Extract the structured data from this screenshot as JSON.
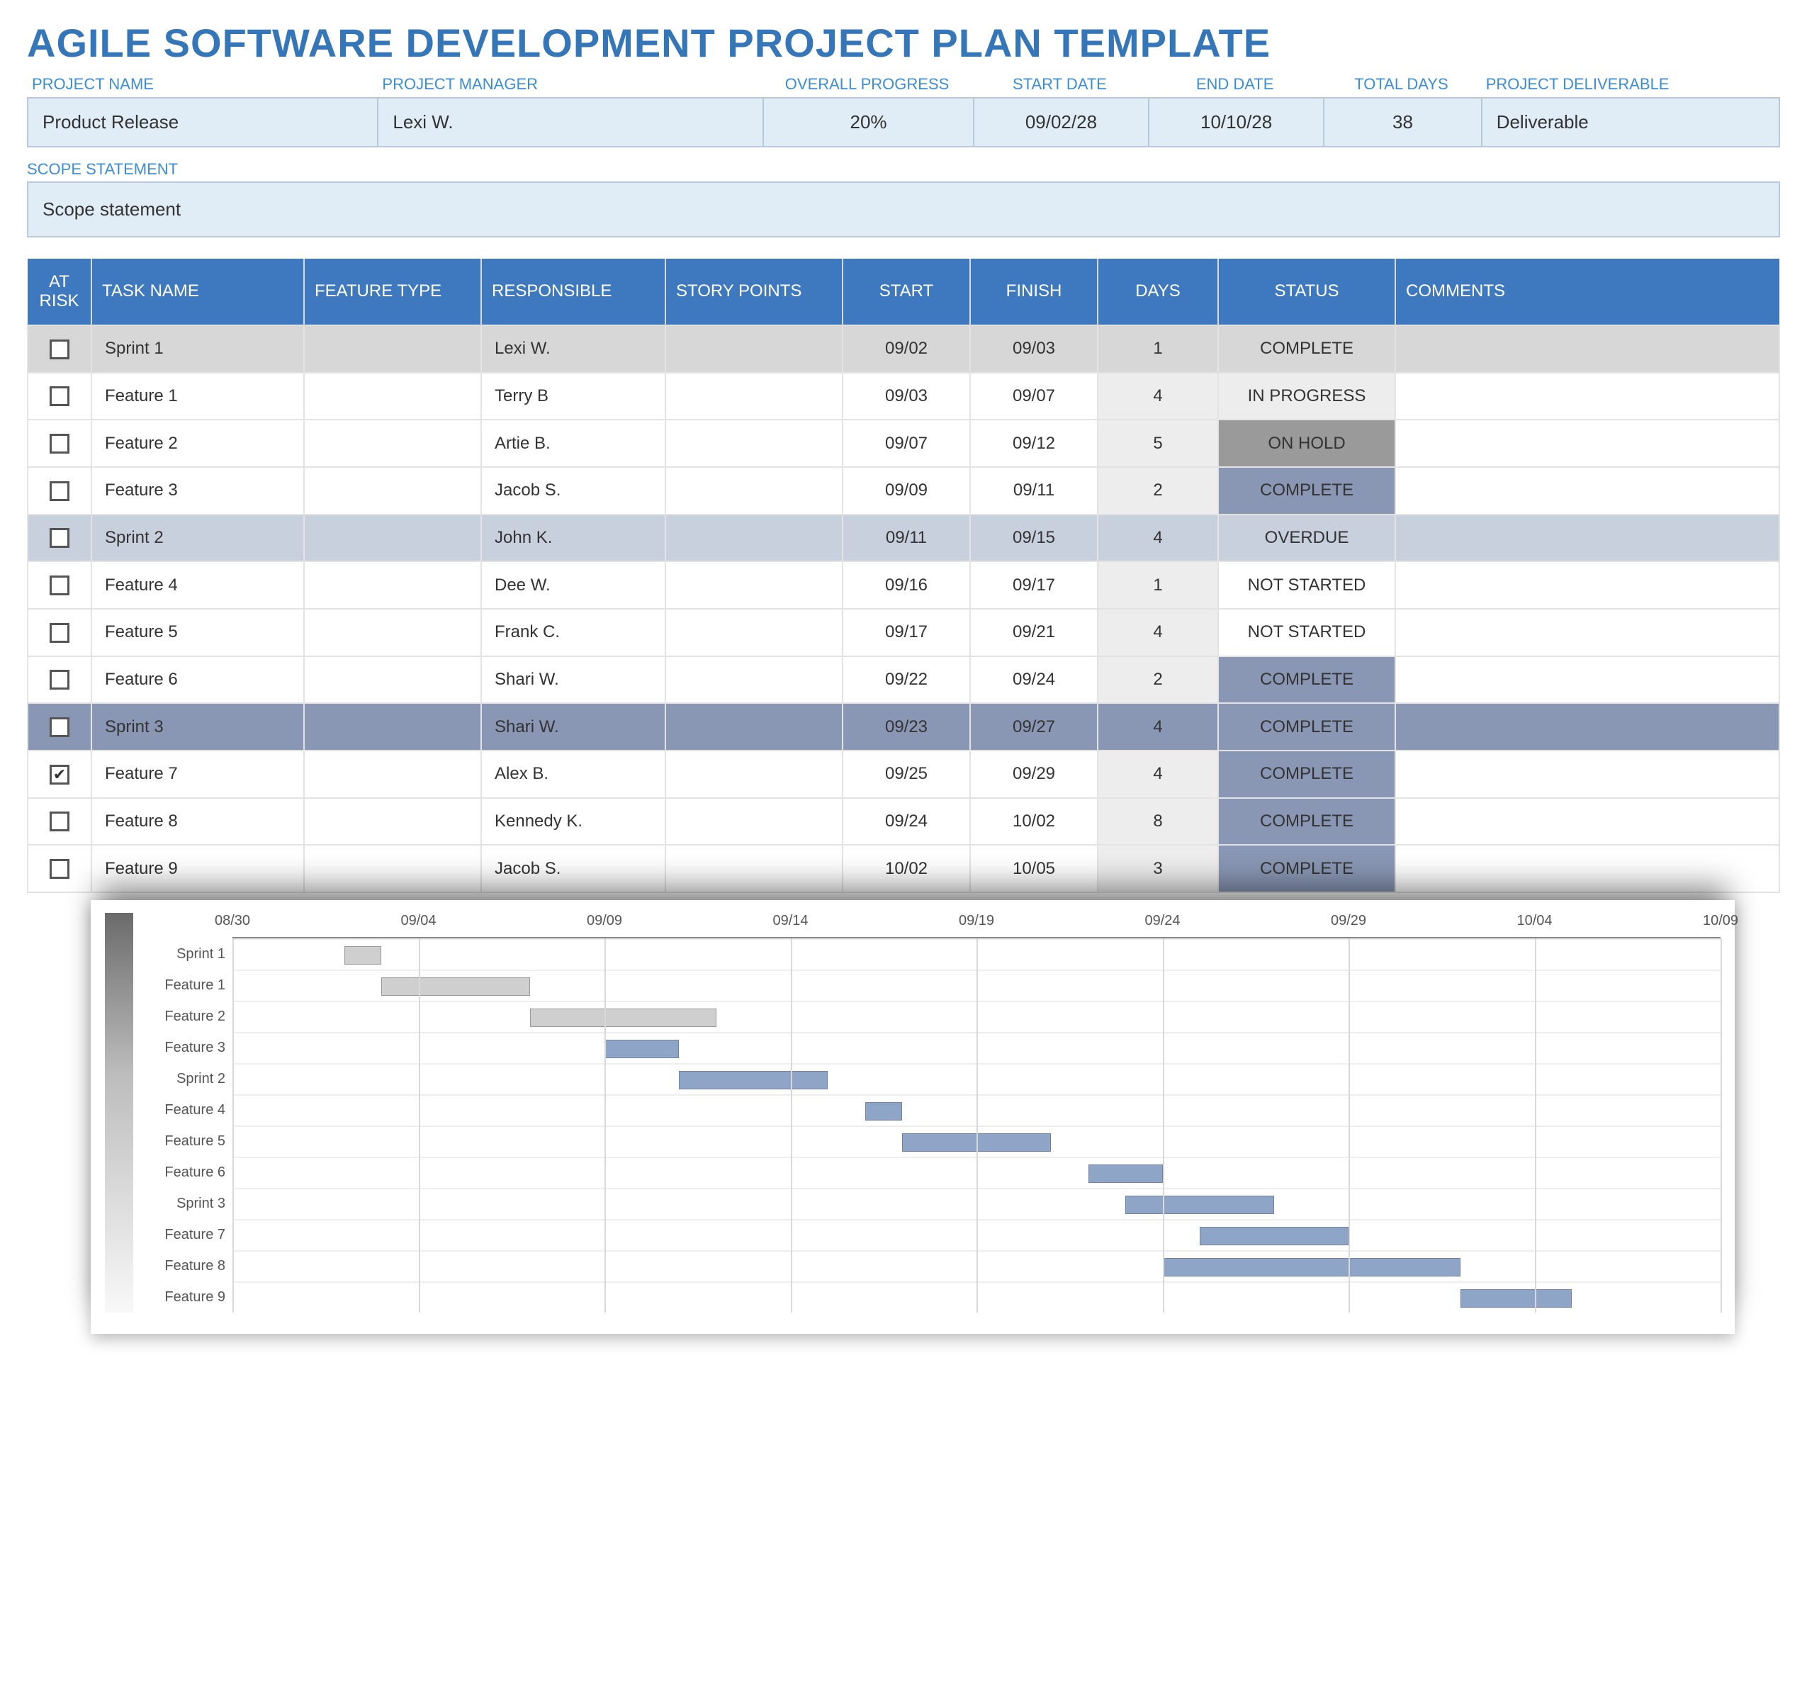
{
  "title": "AGILE SOFTWARE DEVELOPMENT PROJECT PLAN TEMPLATE",
  "info_headers": {
    "project_name": "PROJECT NAME",
    "project_manager": "PROJECT MANAGER",
    "overall_progress": "OVERALL PROGRESS",
    "start_date": "START DATE",
    "end_date": "END DATE",
    "total_days": "TOTAL DAYS",
    "deliverable": "PROJECT DELIVERABLE"
  },
  "info_values": {
    "project_name": "Product Release",
    "project_manager": "Lexi W.",
    "overall_progress": "20%",
    "start_date": "09/02/28",
    "end_date": "10/10/28",
    "total_days": "38",
    "deliverable": "Deliverable"
  },
  "scope": {
    "label": "SCOPE STATEMENT",
    "value": "Scope statement"
  },
  "task_headers": {
    "at_risk": "AT RISK",
    "task_name": "TASK NAME",
    "feature_type": "FEATURE TYPE",
    "responsible": "RESPONSIBLE",
    "story_points": "STORY POINTS",
    "start": "START",
    "finish": "FINISH",
    "days": "DAYS",
    "status": "STATUS",
    "comments": "COMMENTS"
  },
  "tasks": [
    {
      "at_risk": false,
      "name": "Sprint 1",
      "feature_type": "",
      "responsible": "Lexi W.",
      "story_points": "",
      "start": "09/02",
      "finish": "09/03",
      "days": "1",
      "status": "COMPLETE",
      "row_style": "sprint1"
    },
    {
      "at_risk": false,
      "name": "Feature 1",
      "feature_type": "",
      "responsible": "Terry B",
      "story_points": "",
      "start": "09/03",
      "finish": "09/07",
      "days": "4",
      "status": "IN PROGRESS",
      "row_style": ""
    },
    {
      "at_risk": false,
      "name": "Feature 2",
      "feature_type": "",
      "responsible": "Artie B.",
      "story_points": "",
      "start": "09/07",
      "finish": "09/12",
      "days": "5",
      "status": "ON HOLD",
      "row_style": ""
    },
    {
      "at_risk": false,
      "name": "Feature 3",
      "feature_type": "",
      "responsible": "Jacob S.",
      "story_points": "",
      "start": "09/09",
      "finish": "09/11",
      "days": "2",
      "status": "COMPLETE",
      "row_style": ""
    },
    {
      "at_risk": false,
      "name": "Sprint 2",
      "feature_type": "",
      "responsible": "John K.",
      "story_points": "",
      "start": "09/11",
      "finish": "09/15",
      "days": "4",
      "status": "OVERDUE",
      "row_style": "sprint2"
    },
    {
      "at_risk": false,
      "name": "Feature 4",
      "feature_type": "",
      "responsible": "Dee W.",
      "story_points": "",
      "start": "09/16",
      "finish": "09/17",
      "days": "1",
      "status": "NOT STARTED",
      "row_style": ""
    },
    {
      "at_risk": false,
      "name": "Feature 5",
      "feature_type": "",
      "responsible": "Frank C.",
      "story_points": "",
      "start": "09/17",
      "finish": "09/21",
      "days": "4",
      "status": "NOT STARTED",
      "row_style": ""
    },
    {
      "at_risk": false,
      "name": "Feature 6",
      "feature_type": "",
      "responsible": "Shari W.",
      "story_points": "",
      "start": "09/22",
      "finish": "09/24",
      "days": "2",
      "status": "COMPLETE",
      "row_style": ""
    },
    {
      "at_risk": false,
      "name": "Sprint 3",
      "feature_type": "",
      "responsible": "Shari W.",
      "story_points": "",
      "start": "09/23",
      "finish": "09/27",
      "days": "4",
      "status": "COMPLETE",
      "row_style": "sprint3"
    },
    {
      "at_risk": true,
      "name": "Feature 7",
      "feature_type": "",
      "responsible": "Alex B.",
      "story_points": "",
      "start": "09/25",
      "finish": "09/29",
      "days": "4",
      "status": "COMPLETE",
      "row_style": ""
    },
    {
      "at_risk": false,
      "name": "Feature 8",
      "feature_type": "",
      "responsible": "Kennedy K.",
      "story_points": "",
      "start": "09/24",
      "finish": "10/02",
      "days": "8",
      "status": "COMPLETE",
      "row_style": ""
    },
    {
      "at_risk": false,
      "name": "Feature 9",
      "feature_type": "",
      "responsible": "Jacob S.",
      "story_points": "",
      "start": "10/02",
      "finish": "10/05",
      "days": "3",
      "status": "COMPLETE",
      "row_style": ""
    }
  ],
  "chart_data": {
    "type": "gantt",
    "x_axis_dates": [
      "08/30",
      "09/04",
      "09/09",
      "09/14",
      "09/19",
      "09/24",
      "09/29",
      "10/04",
      "10/09"
    ],
    "tasks": [
      {
        "name": "Sprint 1",
        "start": "09/02",
        "finish": "09/03",
        "color": "gray"
      },
      {
        "name": "Feature 1",
        "start": "09/03",
        "finish": "09/07",
        "color": "gray"
      },
      {
        "name": "Feature 2",
        "start": "09/07",
        "finish": "09/12",
        "color": "gray"
      },
      {
        "name": "Feature 3",
        "start": "09/09",
        "finish": "09/11",
        "color": "blue"
      },
      {
        "name": "Sprint 2",
        "start": "09/11",
        "finish": "09/15",
        "color": "blue"
      },
      {
        "name": "Feature 4",
        "start": "09/16",
        "finish": "09/17",
        "color": "blue"
      },
      {
        "name": "Feature 5",
        "start": "09/17",
        "finish": "09/21",
        "color": "blue"
      },
      {
        "name": "Feature 6",
        "start": "09/22",
        "finish": "09/24",
        "color": "blue"
      },
      {
        "name": "Sprint 3",
        "start": "09/23",
        "finish": "09/27",
        "color": "blue"
      },
      {
        "name": "Feature 7",
        "start": "09/25",
        "finish": "09/29",
        "color": "blue"
      },
      {
        "name": "Feature 8",
        "start": "09/24",
        "finish": "10/02",
        "color": "blue"
      },
      {
        "name": "Feature 9",
        "start": "10/02",
        "finish": "10/05",
        "color": "blue"
      }
    ],
    "range_start": "08/30",
    "range_end": "10/09"
  }
}
